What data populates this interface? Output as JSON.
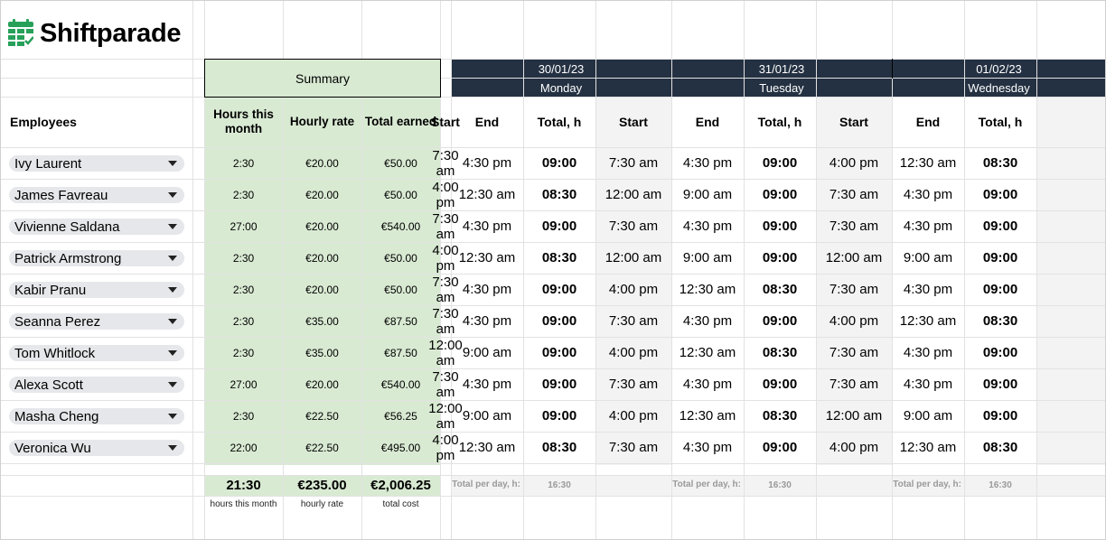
{
  "brand": {
    "name": "Shiftparade",
    "logo_icon": "calendar-grid-icon",
    "accent": "#27a05a"
  },
  "summary": {
    "title": "Summary",
    "col_hours": "Hours this month",
    "col_rate": "Hourly rate",
    "col_total": "Total earned",
    "total_hours": "21:30",
    "total_rate": "€235.00",
    "total_cost": "€2,006.25",
    "label_hours": "hours this month",
    "label_rate": "hourly rate",
    "label_cost": "total cost"
  },
  "employees_header": "Employees",
  "days": [
    {
      "date": "30/01/23",
      "weekday": "Monday",
      "start": "Start",
      "end": "End",
      "total": "Total, h",
      "total_per_day_label": "Total per day, h:",
      "total_per_day": "16:30"
    },
    {
      "date": "31/01/23",
      "weekday": "Tuesday",
      "start": "Start",
      "end": "End",
      "total": "Total, h",
      "total_per_day_label": "Total per day, h:",
      "total_per_day": "16:30"
    },
    {
      "date": "01/02/23",
      "weekday": "Wednesday",
      "start": "Start",
      "end": "End",
      "total": "Total, h",
      "total_per_day_label": "Total per day, h:",
      "total_per_day": "16:30"
    }
  ],
  "rows": [
    {
      "name": "Ivy Laurent",
      "hours": "2:30",
      "rate": "€20.00",
      "earned": "€50.00",
      "shifts": [
        [
          "7:30 am",
          "4:30 pm",
          "09:00"
        ],
        [
          "7:30 am",
          "4:30 pm",
          "09:00"
        ],
        [
          "4:00 pm",
          "12:30 am",
          "08:30"
        ]
      ]
    },
    {
      "name": "James Favreau",
      "hours": "2:30",
      "rate": "€20.00",
      "earned": "€50.00",
      "shifts": [
        [
          "4:00 pm",
          "12:30 am",
          "08:30"
        ],
        [
          "12:00 am",
          "9:00 am",
          "09:00"
        ],
        [
          "7:30 am",
          "4:30 pm",
          "09:00"
        ]
      ]
    },
    {
      "name": "Vivienne Saldana",
      "hours": "27:00",
      "rate": "€20.00",
      "earned": "€540.00",
      "shifts": [
        [
          "7:30 am",
          "4:30 pm",
          "09:00"
        ],
        [
          "7:30 am",
          "4:30 pm",
          "09:00"
        ],
        [
          "7:30 am",
          "4:30 pm",
          "09:00"
        ]
      ]
    },
    {
      "name": "Patrick Armstrong",
      "hours": "2:30",
      "rate": "€20.00",
      "earned": "€50.00",
      "shifts": [
        [
          "4:00 pm",
          "12:30 am",
          "08:30"
        ],
        [
          "12:00 am",
          "9:00 am",
          "09:00"
        ],
        [
          "12:00 am",
          "9:00 am",
          "09:00"
        ]
      ]
    },
    {
      "name": "Kabir Pranu",
      "hours": "2:30",
      "rate": "€20.00",
      "earned": "€50.00",
      "shifts": [
        [
          "7:30 am",
          "4:30 pm",
          "09:00"
        ],
        [
          "4:00 pm",
          "12:30 am",
          "08:30"
        ],
        [
          "7:30 am",
          "4:30 pm",
          "09:00"
        ]
      ]
    },
    {
      "name": "Seanna Perez",
      "hours": "2:30",
      "rate": "€35.00",
      "earned": "€87.50",
      "shifts": [
        [
          "7:30 am",
          "4:30 pm",
          "09:00"
        ],
        [
          "7:30 am",
          "4:30 pm",
          "09:00"
        ],
        [
          "4:00 pm",
          "12:30 am",
          "08:30"
        ]
      ]
    },
    {
      "name": "Tom Whitlock",
      "hours": "2:30",
      "rate": "€35.00",
      "earned": "€87.50",
      "shifts": [
        [
          "12:00 am",
          "9:00 am",
          "09:00"
        ],
        [
          "4:00 pm",
          "12:30 am",
          "08:30"
        ],
        [
          "7:30 am",
          "4:30 pm",
          "09:00"
        ]
      ]
    },
    {
      "name": "Alexa Scott",
      "hours": "27:00",
      "rate": "€20.00",
      "earned": "€540.00",
      "shifts": [
        [
          "7:30 am",
          "4:30 pm",
          "09:00"
        ],
        [
          "7:30 am",
          "4:30 pm",
          "09:00"
        ],
        [
          "7:30 am",
          "4:30 pm",
          "09:00"
        ]
      ]
    },
    {
      "name": "Masha Cheng",
      "hours": "2:30",
      "rate": "€22.50",
      "earned": "€56.25",
      "shifts": [
        [
          "12:00 am",
          "9:00 am",
          "09:00"
        ],
        [
          "4:00 pm",
          "12:30 am",
          "08:30"
        ],
        [
          "12:00 am",
          "9:00 am",
          "09:00"
        ]
      ]
    },
    {
      "name": "Veronica Wu",
      "hours": "22:00",
      "rate": "€22.50",
      "earned": "€495.00",
      "shifts": [
        [
          "4:00 pm",
          "12:30 am",
          "08:30"
        ],
        [
          "7:30 am",
          "4:30 pm",
          "09:00"
        ],
        [
          "4:00 pm",
          "12:30 am",
          "08:30"
        ]
      ]
    }
  ]
}
